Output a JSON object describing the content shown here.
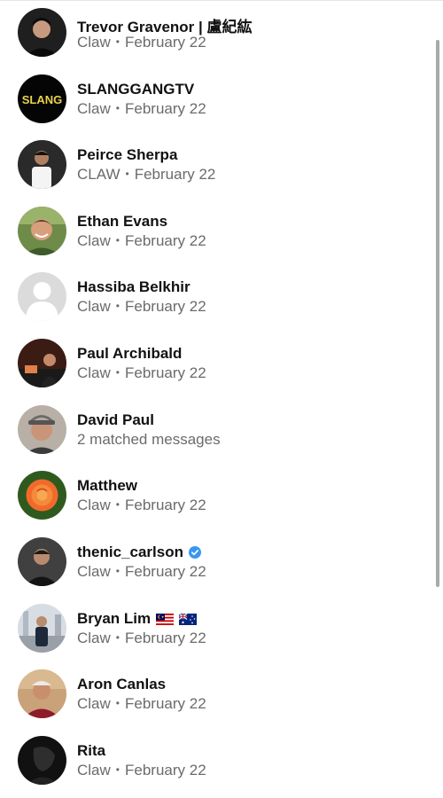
{
  "results": [
    {
      "name": "Trevor Gravenor | 盧紀紘",
      "label": "Claw",
      "date": "February 22",
      "avatar": "dark-avatar",
      "badge": null
    },
    {
      "name": "SLANGGANGTV",
      "label": "Claw",
      "date": "February 22",
      "avatar": "slang-logo",
      "avatar_text": "SLANG",
      "badge": null
    },
    {
      "name": "Peirce Sherpa",
      "label": "CLAW",
      "date": "February 22",
      "avatar": "person-avatar",
      "badge": null
    },
    {
      "name": "Ethan Evans",
      "label": "Claw",
      "date": "February 22",
      "avatar": "person-avatar",
      "badge": null
    },
    {
      "name": "Hassiba Belkhir",
      "label": "Claw",
      "date": "February 22",
      "avatar": "default-silhouette",
      "badge": null
    },
    {
      "name": "Paul Archibald",
      "label": "Claw",
      "date": "February 22",
      "avatar": "person-avatar",
      "badge": null
    },
    {
      "name": "David Paul",
      "summary": "2 matched messages",
      "avatar": "person-avatar",
      "badge": null
    },
    {
      "name": "Matthew",
      "label": "Claw",
      "date": "February 22",
      "avatar": "rose-avatar",
      "badge": null
    },
    {
      "name": "thenic_carlson",
      "label": "Claw",
      "date": "February 22",
      "avatar": "person-avatar",
      "badge": "verified-badge"
    },
    {
      "name": "Bryan Lim",
      "label": "Claw",
      "date": "February 22",
      "avatar": "person-avatar",
      "badge": "flags"
    },
    {
      "name": "Aron Canlas",
      "label": "Claw",
      "date": "February 22",
      "avatar": "person-avatar",
      "badge": null
    },
    {
      "name": "Rita",
      "label": "Claw",
      "date": "February 22",
      "avatar": "dark-avatar",
      "badge": null
    }
  ],
  "colors": {
    "primary_text": "#111111",
    "secondary_text": "#6b6b6b",
    "verified": "#3897f0",
    "scrollbar": "#a9a9a9"
  }
}
